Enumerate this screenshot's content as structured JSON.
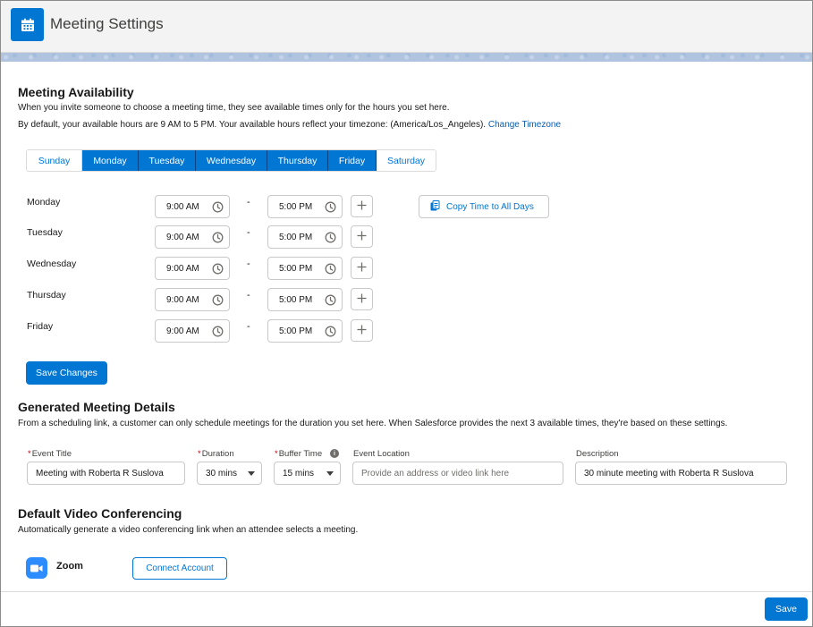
{
  "header": {
    "title": "Meeting Settings",
    "icon": "calendar-icon"
  },
  "availability": {
    "heading": "Meeting Availability",
    "desc1": "When you invite someone to choose a meeting time, they see available times only for the hours you set here.",
    "desc2": "By default, your available hours are 9 AM to 5 PM. Your available hours reflect your timezone: (America/Los_Angeles).",
    "change_timezone": "Change Timezone",
    "days": [
      {
        "label": "Sunday",
        "selected": false
      },
      {
        "label": "Monday",
        "selected": true
      },
      {
        "label": "Tuesday",
        "selected": true
      },
      {
        "label": "Wednesday",
        "selected": true
      },
      {
        "label": "Thursday",
        "selected": true
      },
      {
        "label": "Friday",
        "selected": true
      },
      {
        "label": "Saturday",
        "selected": false
      }
    ],
    "rows": [
      {
        "day": "Monday",
        "start": "9:00 AM",
        "end": "5:00 PM"
      },
      {
        "day": "Tuesday",
        "start": "9:00 AM",
        "end": "5:00 PM"
      },
      {
        "day": "Wednesday",
        "start": "9:00 AM",
        "end": "5:00 PM"
      },
      {
        "day": "Thursday",
        "start": "9:00 AM",
        "end": "5:00 PM"
      },
      {
        "day": "Friday",
        "start": "9:00 AM",
        "end": "5:00 PM"
      }
    ],
    "separator": "-",
    "copy_button": "Copy Time to All Days",
    "save_button": "Save Changes"
  },
  "details": {
    "heading": "Generated Meeting Details",
    "desc": "From a scheduling link, a customer can only schedule meetings for the duration you set here. When Salesforce provides the next 3 available times, they're based on these settings.",
    "required_mark": "*",
    "event_title": {
      "label": "Event Title",
      "value": "Meeting with Roberta R Suslova"
    },
    "duration": {
      "label": "Duration",
      "value": "30 mins"
    },
    "buffer_time": {
      "label": "Buffer Time",
      "value": "15 mins",
      "info": "i"
    },
    "event_location": {
      "label": "Event Location",
      "placeholder": "Provide an address or video link here"
    },
    "description": {
      "label": "Description",
      "value": "30 minute meeting with Roberta R Suslova"
    }
  },
  "video": {
    "heading": "Default Video Conferencing",
    "desc": "Automatically generate a video conferencing link when an attendee selects a meeting.",
    "provider": "Zoom",
    "connect_button": "Connect Account"
  },
  "footer": {
    "save_button": "Save"
  },
  "colors": {
    "brand": "#0176d3",
    "zoom": "#2d8cff"
  }
}
